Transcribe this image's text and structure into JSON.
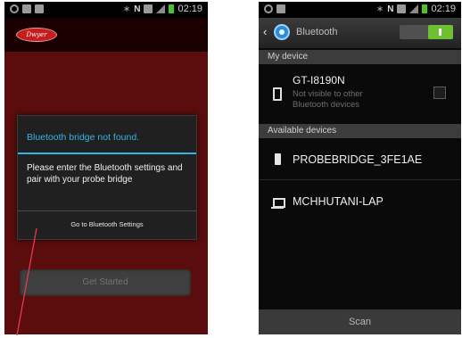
{
  "left_screen": {
    "status_bar": {
      "time": "02:19",
      "network_icon": "N"
    },
    "logo_text": "Dwyer",
    "dialog": {
      "title": "Bluetooth bridge not found.",
      "message": "Please enter the Bluetooth settings and pair with your probe bridge",
      "button_label": "Go to Bluetooth Settings"
    },
    "get_started_label": "Get Started",
    "colors": {
      "accent": "#33b5e5",
      "background": "#5a0d0c"
    }
  },
  "right_screen": {
    "status_bar": {
      "time": "02:19",
      "network_icon": "N"
    },
    "header": {
      "title": "Bluetooth",
      "toggle_state": "on"
    },
    "my_device_section": "My device",
    "my_device": {
      "name": "GT-I8190N",
      "subtitle": "Not visible to other Bluetooth devices"
    },
    "available_section": "Available devices",
    "available_devices": [
      {
        "name": "PROBEBRIDGE_3FE1AE",
        "icon": "bridge-device-icon"
      },
      {
        "name": "MCHHUTANI-LAP",
        "icon": "laptop-icon"
      }
    ],
    "scan_label": "Scan",
    "colors": {
      "toggle_on": "#6fbf32"
    }
  }
}
